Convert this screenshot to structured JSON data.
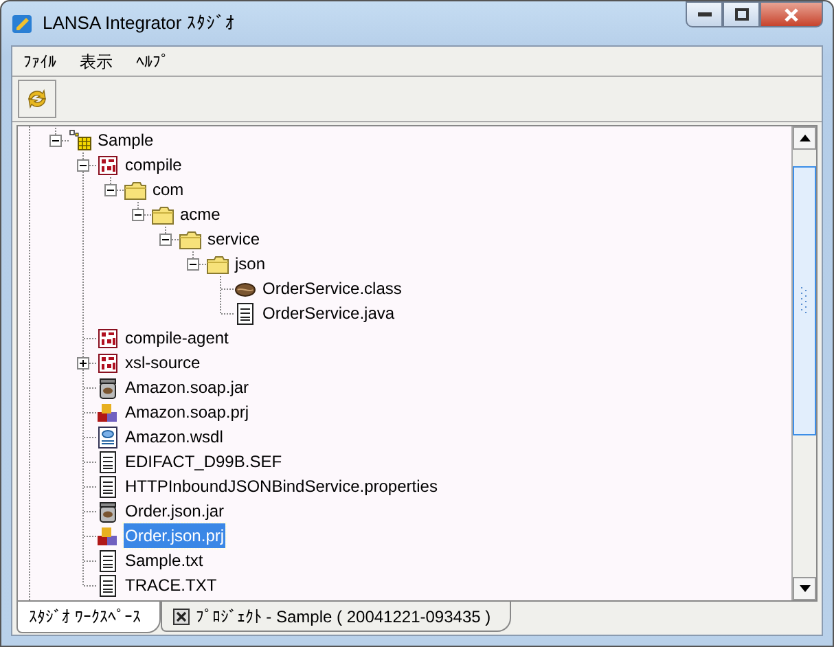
{
  "window": {
    "title": "LANSA Integrator ｽﾀｼﾞｵ"
  },
  "menu": [
    "ﾌｧｲﾙ",
    "表示",
    "ﾍﾙﾌﾟ"
  ],
  "tree": [
    {
      "label": "Sample",
      "kind": "project",
      "expanded": true,
      "selected": false,
      "children": [
        {
          "label": "compile",
          "kind": "module",
          "expanded": true,
          "selected": false,
          "children": [
            {
              "label": "com",
              "kind": "folder",
              "expanded": true,
              "selected": false,
              "children": [
                {
                  "label": "acme",
                  "kind": "folder",
                  "expanded": true,
                  "selected": false,
                  "children": [
                    {
                      "label": "service",
                      "kind": "folder",
                      "expanded": true,
                      "selected": false,
                      "children": [
                        {
                          "label": "json",
                          "kind": "folder",
                          "expanded": true,
                          "selected": false,
                          "children": [
                            {
                              "label": "OrderService.class",
                              "kind": "class",
                              "selected": false
                            },
                            {
                              "label": "OrderService.java",
                              "kind": "text",
                              "selected": false
                            }
                          ]
                        }
                      ]
                    }
                  ]
                }
              ]
            }
          ]
        },
        {
          "label": "compile-agent",
          "kind": "module",
          "selected": false
        },
        {
          "label": "xsl-source",
          "kind": "module",
          "expanded": false,
          "selected": false
        },
        {
          "label": "Amazon.soap.jar",
          "kind": "jar",
          "selected": false
        },
        {
          "label": "Amazon.soap.prj",
          "kind": "prj",
          "selected": false
        },
        {
          "label": "Amazon.wsdl",
          "kind": "wsdl",
          "selected": false
        },
        {
          "label": "EDIFACT_D99B.SEF",
          "kind": "text",
          "selected": false
        },
        {
          "label": "HTTPInboundJSONBindService.properties",
          "kind": "text",
          "selected": false
        },
        {
          "label": "Order.json.jar",
          "kind": "jar",
          "selected": false
        },
        {
          "label": "Order.json.prj",
          "kind": "prj",
          "selected": true
        },
        {
          "label": "Sample.txt",
          "kind": "text",
          "selected": false
        },
        {
          "label": "TRACE.TXT",
          "kind": "text",
          "selected": false
        }
      ]
    }
  ],
  "tabs": [
    {
      "label": "ｽﾀｼﾞｵ ﾜｰｸｽﾍﾟｰｽ",
      "selected": true,
      "closable": false
    },
    {
      "label": "ﾌﾟﾛｼﾞｪｸﾄ - Sample ( 20041221-093435 )",
      "selected": false,
      "closable": true
    }
  ]
}
